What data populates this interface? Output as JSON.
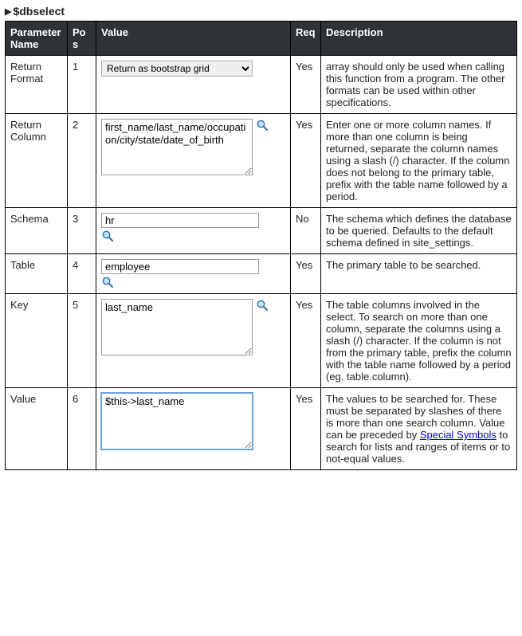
{
  "title": "$dbselect",
  "columns": {
    "param": "Parameter Name",
    "pos": "Pos",
    "value": "Value",
    "req": "Req",
    "desc": "Description"
  },
  "rows": [
    {
      "param": "Return Format",
      "pos": "1",
      "control": "select",
      "value": "Return as bootstrap grid",
      "req": "Yes",
      "desc": "array should only be used when calling this function from a program. The other formats can be used within other specifications."
    },
    {
      "param": "Return Column",
      "pos": "2",
      "control": "textarea_mag",
      "value": "first_name/last_name/occupation/city/state/date_of_birth",
      "req": "Yes",
      "desc": "Enter one or more column names. If more than one column is being returned, separate the column names using a slash (/) character. If the column does not belong to the primary table, prefix with the table name followed by a period."
    },
    {
      "param": "Schema",
      "pos": "3",
      "control": "input_mag_below",
      "value": "hr",
      "req": "No",
      "desc": "The schema which defines the database to be queried. Defaults to the default schema defined in site_settings."
    },
    {
      "param": "Table",
      "pos": "4",
      "control": "input_mag_below",
      "value": "employee",
      "req": "Yes",
      "desc": "The primary table to be searched."
    },
    {
      "param": "Key",
      "pos": "5",
      "control": "textarea_mag",
      "value": "last_name",
      "req": "Yes",
      "desc": "The table columns involved in the select. To search on more than one column, separate the columns using a slash (/) character. If the column is not from the primary table, prefix the column with the table name followed by a period (eg. table.column)."
    },
    {
      "param": "Value",
      "pos": "6",
      "control": "textarea_focused",
      "value": "$this->last_name",
      "req": "Yes",
      "desc_parts": [
        "The values to be searched for. These must be separated by slashes of there is more than one search column. Value can be preceded by ",
        " to search for lists and ranges of items or to not-equal values."
      ],
      "link_text": "Special Symbols"
    }
  ]
}
